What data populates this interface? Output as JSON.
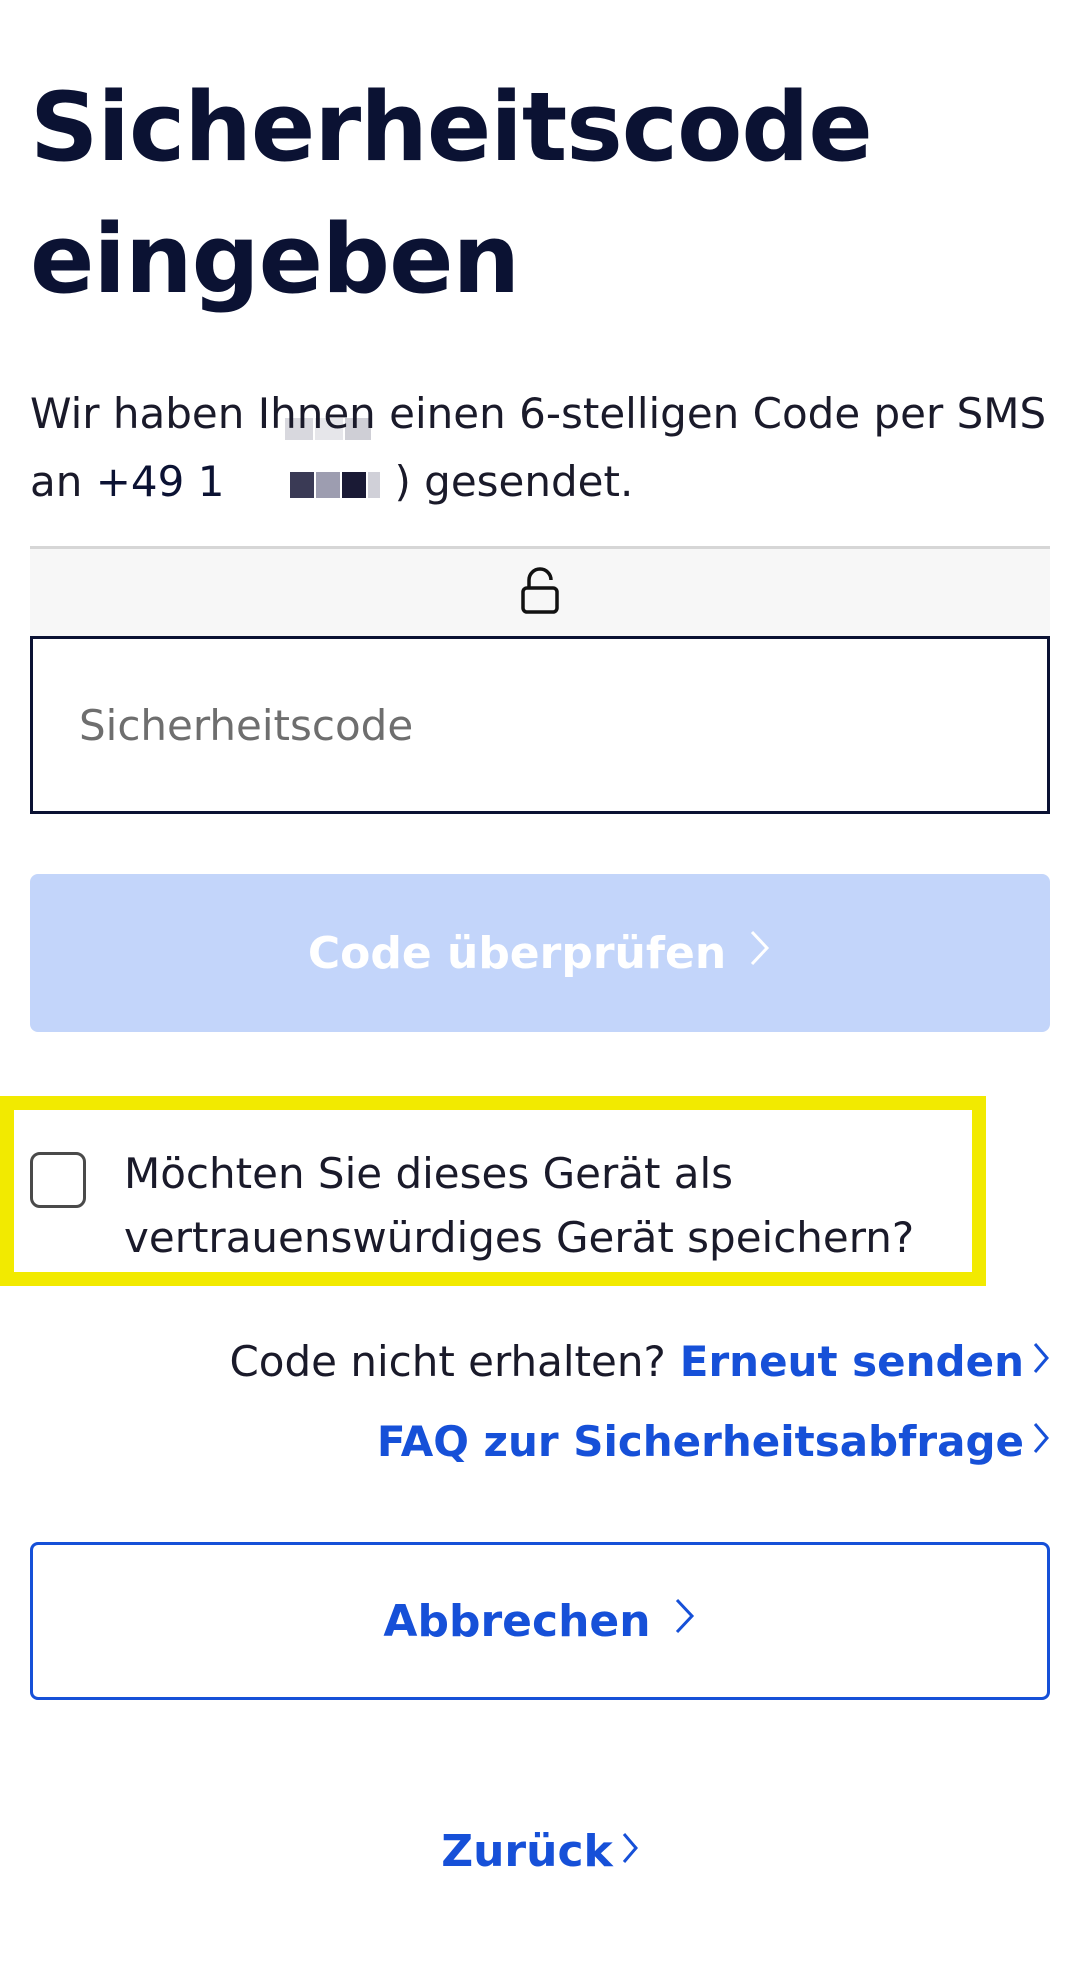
{
  "page": {
    "title": "Sicherheitscode eingeben",
    "intro_prefix": "Wir haben Ihnen einen 6-stelligen Code per SMS an ",
    "phone_visible": "+49 1",
    "intro_suffix": ") gesendet."
  },
  "form": {
    "code_placeholder": "Sicherheitscode",
    "code_value": "",
    "verify_label": "Code überprüfen",
    "trust_device_label": "Möchten Sie dieses Gerät als vertrauenswürdiges Gerät speichern?",
    "trust_device_checked": false
  },
  "links": {
    "not_received": "Code nicht erhalten?",
    "resend": "Erneut senden",
    "faq": "FAQ zur Sicherheitsabfrage",
    "cancel": "Abbrechen",
    "back": "Zurück"
  },
  "icons": {
    "lock": "lock-icon",
    "chevron": "chevron-right-icon"
  },
  "colors": {
    "primary": "#1650d8",
    "title": "#0b1233",
    "disabled_button": "#c3d5fa",
    "highlight": "#f2ea00"
  }
}
